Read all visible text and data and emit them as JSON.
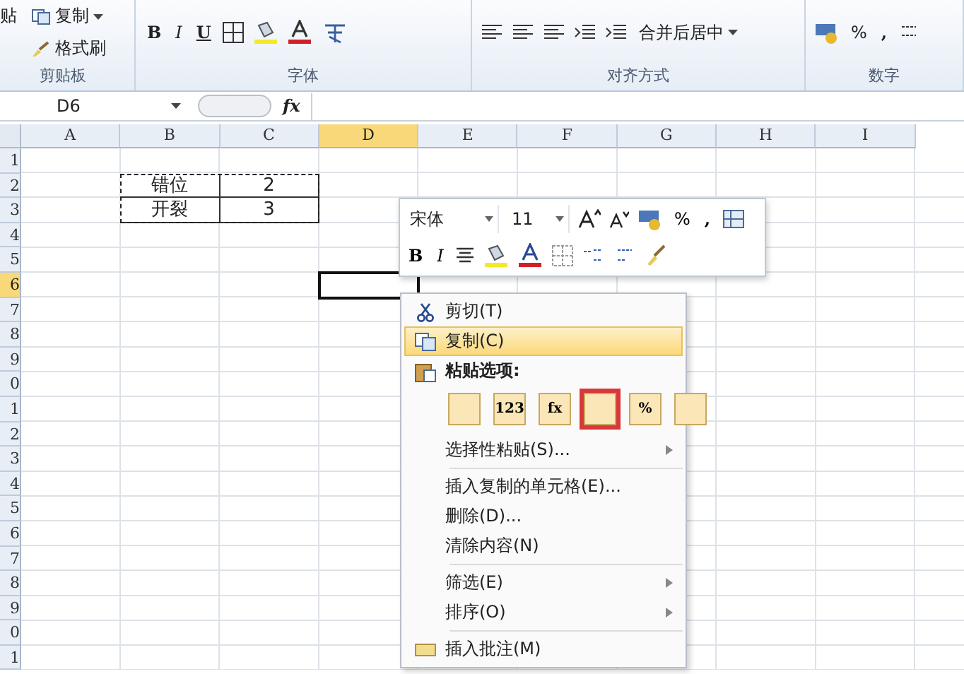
{
  "ribbon": {
    "groups": [
      {
        "label": "剪贴板",
        "kind": "clipboard",
        "paste": "贴",
        "commands": [
          {
            "label": "复制",
            "caret": true
          },
          {
            "label": "格式刷",
            "caret": false
          }
        ]
      },
      {
        "label": "字体",
        "kind": "font",
        "bold": "B",
        "italic": "I",
        "underline": "U"
      },
      {
        "label": "对齐方式",
        "kind": "align",
        "merge": "合并后居中"
      },
      {
        "label": "数字",
        "kind": "number",
        "percent": "%",
        "comma": ","
      }
    ]
  },
  "formula_bar": {
    "name_box": "D6",
    "fx": "fx"
  },
  "sheet": {
    "columns": [
      {
        "label": "A",
        "selected": false
      },
      {
        "label": "B",
        "selected": false
      },
      {
        "label": "C",
        "selected": false
      },
      {
        "label": "D",
        "selected": true
      },
      {
        "label": "E",
        "selected": false
      },
      {
        "label": "F",
        "selected": false
      },
      {
        "label": "G",
        "selected": false
      },
      {
        "label": "H",
        "selected": false
      },
      {
        "label": "I",
        "selected": false
      }
    ],
    "rows": [
      {
        "label": "1",
        "selected": false
      },
      {
        "label": "2",
        "selected": false,
        "cells": {
          "B": {
            "text": "错位",
            "copied": true
          },
          "C": {
            "text": "2",
            "copied": true
          }
        }
      },
      {
        "label": "3",
        "selected": false,
        "cells": {
          "B": {
            "text": "开裂",
            "copied": true
          },
          "C": {
            "text": "3",
            "copied": true
          }
        }
      },
      {
        "label": "4",
        "selected": false
      },
      {
        "label": "5",
        "selected": false
      },
      {
        "label": "6",
        "selected": true
      },
      {
        "label": "7",
        "selected": false
      },
      {
        "label": "8",
        "selected": false
      },
      {
        "label": "9",
        "selected": false
      },
      {
        "label": "0",
        "selected": false
      },
      {
        "label": "1",
        "selected": false
      },
      {
        "label": "2",
        "selected": false
      },
      {
        "label": "3",
        "selected": false
      },
      {
        "label": "4",
        "selected": false
      },
      {
        "label": "5",
        "selected": false
      },
      {
        "label": "6",
        "selected": false
      },
      {
        "label": "7",
        "selected": false
      },
      {
        "label": "8",
        "selected": false
      },
      {
        "label": "9",
        "selected": false
      },
      {
        "label": "0",
        "selected": false
      },
      {
        "label": "1",
        "selected": false
      }
    ]
  },
  "mini_toolbar": {
    "font": "宋体",
    "size": "11",
    "percent": "%",
    "comma": ",",
    "bold": "B",
    "italic": "I"
  },
  "context_menu": {
    "items": [
      {
        "kind": "command",
        "label": "剪切(T)",
        "selected": false,
        "submenu": false
      },
      {
        "kind": "command",
        "label": "复制(C)",
        "selected": true,
        "submenu": false
      },
      {
        "kind": "header",
        "label": "粘贴选项:"
      },
      {
        "kind": "paste-icons",
        "options": [
          {
            "selected": false
          },
          {
            "glyph": "123",
            "selected": false
          },
          {
            "glyph": "fx",
            "selected": false
          },
          {
            "selected": true
          },
          {
            "glyph": "%",
            "selected": false
          },
          {
            "selected": false
          }
        ]
      },
      {
        "kind": "command",
        "label": "选择性粘贴(S)...",
        "selected": false,
        "submenu": true
      },
      {
        "kind": "separator"
      },
      {
        "kind": "command",
        "label": "插入复制的单元格(E)...",
        "selected": false,
        "submenu": false
      },
      {
        "kind": "command",
        "label": "删除(D)...",
        "selected": false,
        "submenu": false
      },
      {
        "kind": "command",
        "label": "清除内容(N)",
        "selected": false,
        "submenu": false
      },
      {
        "kind": "separator"
      },
      {
        "kind": "command",
        "label": "筛选(E)",
        "selected": false,
        "submenu": true
      },
      {
        "kind": "command",
        "label": "排序(O)",
        "selected": false,
        "submenu": true
      },
      {
        "kind": "separator"
      },
      {
        "kind": "command",
        "label": "插入批注(M)",
        "selected": false,
        "submenu": false
      }
    ]
  }
}
